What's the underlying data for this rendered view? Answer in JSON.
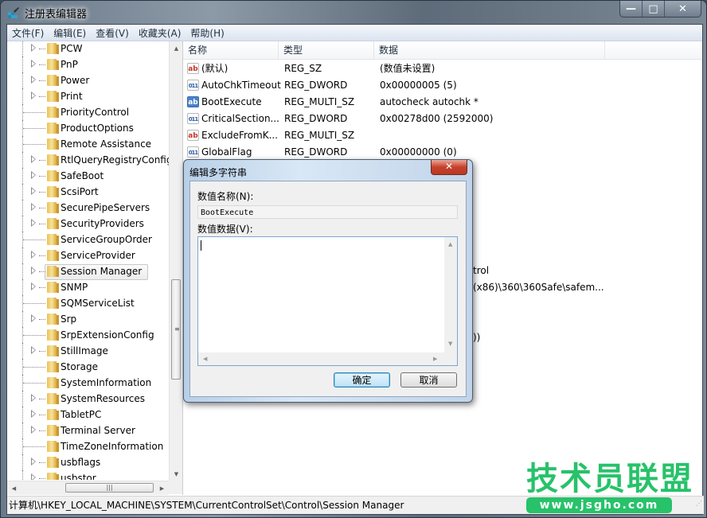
{
  "window": {
    "title": "注册表编辑器",
    "controls": {
      "minimize": "—",
      "maximize": "□",
      "close": "✕"
    }
  },
  "menubar": [
    "文件(F)",
    "编辑(E)",
    "查看(V)",
    "收藏夹(A)",
    "帮助(H)"
  ],
  "tree": {
    "items": [
      {
        "label": "PCW",
        "expandable": true
      },
      {
        "label": "PnP",
        "expandable": true
      },
      {
        "label": "Power",
        "expandable": true
      },
      {
        "label": "Print",
        "expandable": true
      },
      {
        "label": "PriorityControl",
        "expandable": false
      },
      {
        "label": "ProductOptions",
        "expandable": false
      },
      {
        "label": "Remote Assistance",
        "expandable": false
      },
      {
        "label": "RtlQueryRegistryConfig",
        "expandable": true
      },
      {
        "label": "SafeBoot",
        "expandable": true
      },
      {
        "label": "ScsiPort",
        "expandable": true
      },
      {
        "label": "SecurePipeServers",
        "expandable": true
      },
      {
        "label": "SecurityProviders",
        "expandable": true
      },
      {
        "label": "ServiceGroupOrder",
        "expandable": false
      },
      {
        "label": "ServiceProvider",
        "expandable": true
      },
      {
        "label": "Session Manager",
        "expandable": true,
        "selected": true
      },
      {
        "label": "SNMP",
        "expandable": true
      },
      {
        "label": "SQMServiceList",
        "expandable": false
      },
      {
        "label": "Srp",
        "expandable": true
      },
      {
        "label": "SrpExtensionConfig",
        "expandable": false
      },
      {
        "label": "StillImage",
        "expandable": true
      },
      {
        "label": "Storage",
        "expandable": false
      },
      {
        "label": "SystemInformation",
        "expandable": false
      },
      {
        "label": "SystemResources",
        "expandable": true
      },
      {
        "label": "TabletPC",
        "expandable": true
      },
      {
        "label": "Terminal Server",
        "expandable": true
      },
      {
        "label": "TimeZoneInformation",
        "expandable": false
      },
      {
        "label": "usbflags",
        "expandable": true
      },
      {
        "label": "usbstor",
        "expandable": true
      }
    ]
  },
  "values": {
    "columns": [
      "名称",
      "类型",
      "数据"
    ],
    "rows": [
      {
        "icon": "sz",
        "name": "(默认)",
        "type": "REG_SZ",
        "data": "(数值未设置)"
      },
      {
        "icon": "dword",
        "name": "AutoChkTimeout",
        "type": "REG_DWORD",
        "data": "0x00000005 (5)"
      },
      {
        "icon": "multi",
        "name": "BootExecute",
        "type": "REG_MULTI_SZ",
        "data": "autocheck autochk *"
      },
      {
        "icon": "dword",
        "name": "CriticalSection...",
        "type": "REG_DWORD",
        "data": "0x00278d00 (2592000)"
      },
      {
        "icon": "sz",
        "name": "ExcludeFromK...",
        "type": "REG_MULTI_SZ",
        "data": ""
      },
      {
        "icon": "dword",
        "name": "GlobalFlag",
        "type": "REG_DWORD",
        "data": "0x00000000 (0)"
      }
    ],
    "partial_behind_dialog": [
      "trol",
      "(x86)\\360\\360Safe\\safem...",
      "))"
    ]
  },
  "statusbar": {
    "path": "计算机\\HKEY_LOCAL_MACHINE\\SYSTEM\\CurrentControlSet\\Control\\Session Manager"
  },
  "dialog": {
    "title": "编辑多字符串",
    "close": "✕",
    "name_label": "数值名称(N):",
    "name_value": "BootExecute",
    "data_label": "数值数据(V):",
    "data_value": "",
    "ok_label": "确定",
    "cancel_label": "取消"
  },
  "watermark": {
    "title": "技术员联盟",
    "url": "www.jsgho.com",
    "color": "#27c26a"
  }
}
